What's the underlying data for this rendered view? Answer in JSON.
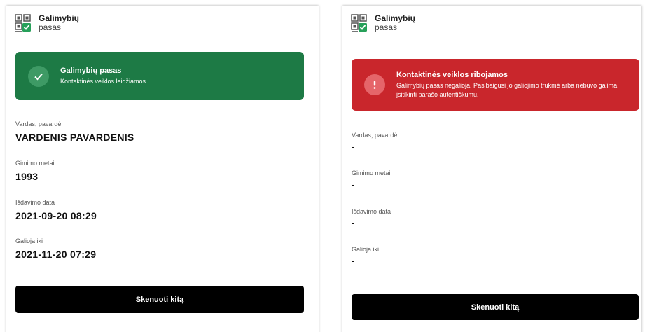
{
  "valid_card": {
    "logo": {
      "line1": "Galimybių",
      "line2": "pasas"
    },
    "banner": {
      "title": "Galimybių pasas",
      "description": "Kontaktinės veiklos leidžiamos",
      "color": "#1d7a45",
      "icon": "checkmark-icon"
    },
    "fields": [
      {
        "label": "Vardas, pavardė",
        "value": "VARDENIS PAVARDENIS"
      },
      {
        "label": "Gimimo metai",
        "value": "1993"
      },
      {
        "label": "Išdavimo data",
        "value": "2021-09-20 08:29"
      },
      {
        "label": "Galioja iki",
        "value": "2021-11-20 07:29"
      }
    ],
    "button_label": "Skenuoti kitą"
  },
  "invalid_card": {
    "logo": {
      "line1": "Galimybių",
      "line2": "pasas"
    },
    "banner": {
      "title": "Kontaktinės veiklos ribojamos",
      "description": "Galimybių pasas negalioja. Pasibaigusi jo galiojimo trukmė arba nebuvo galima įsitikinti parašo autentiškumu.",
      "color": "#c9262c",
      "icon": "exclamation-icon"
    },
    "fields": [
      {
        "label": "Vardas, pavardė",
        "value": "-"
      },
      {
        "label": "Gimimo metai",
        "value": "-"
      },
      {
        "label": "Išdavimo data",
        "value": "-"
      },
      {
        "label": "Galioja iki",
        "value": "-"
      }
    ],
    "button_label": "Skenuoti kitą"
  }
}
